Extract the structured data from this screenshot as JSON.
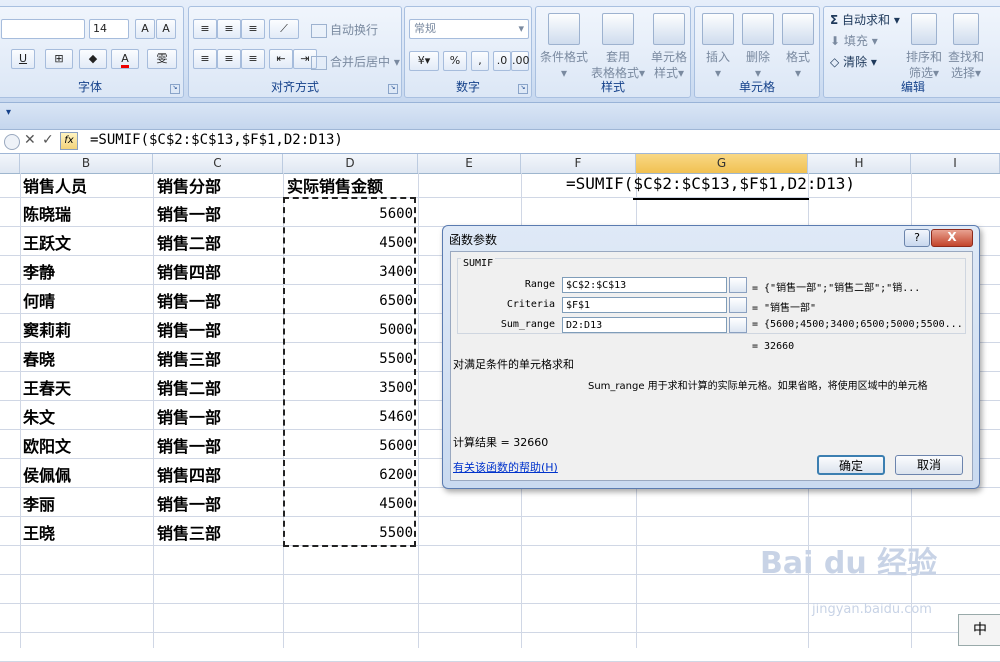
{
  "ribbon": {
    "font_group_label": "字体",
    "font_size": "14",
    "align_group_label": "对齐方式",
    "wrap_text": "自动换行",
    "merge_center": "合并后居中",
    "number_group_label": "数字",
    "number_format": "常规",
    "styles_group_label": "样式",
    "cond_format": "条件格式",
    "table_format_line1": "套用",
    "table_format_line2": "表格格式",
    "cell_style_line1": "单元格",
    "cell_style_line2": "样式",
    "cells_group_label": "单元格",
    "insert": "插入",
    "delete": "删除",
    "format": "格式",
    "edit_group_label": "编辑",
    "autosum": "自动求和",
    "fill": "填充",
    "clear": "清除",
    "sort_filter_line1": "排序和",
    "sort_filter_line2": "筛选",
    "find_select_line1": "查找和",
    "find_select_line2": "选择"
  },
  "formula_bar": {
    "fx": "fx",
    "formula": "=SUMIF($C$2:$C$13,$F$1,D2:D13)"
  },
  "columns": [
    "B",
    "C",
    "D",
    "E",
    "F",
    "G",
    "H",
    "I"
  ],
  "table": {
    "headers": [
      "销售人员",
      "销售分部",
      "实际销售金额"
    ],
    "rows": [
      [
        "陈晓瑞",
        "销售一部",
        "5600"
      ],
      [
        "王跃文",
        "销售二部",
        "4500"
      ],
      [
        "李静",
        "销售四部",
        "3400"
      ],
      [
        "何晴",
        "销售一部",
        "6500"
      ],
      [
        "窦莉莉",
        "销售一部",
        "5000"
      ],
      [
        "春晓",
        "销售三部",
        "5500"
      ],
      [
        "王春天",
        "销售二部",
        "3500"
      ],
      [
        "朱文",
        "销售一部",
        "5460"
      ],
      [
        "欧阳文",
        "销售一部",
        "5600"
      ],
      [
        "侯佩佩",
        "销售四部",
        "6200"
      ],
      [
        "李丽",
        "销售一部",
        "4500"
      ],
      [
        "王晓",
        "销售三部",
        "5500"
      ]
    ]
  },
  "cell_formula": "=SUMIF($C$2:$C$13,$F$1,D2:D13)",
  "dialog": {
    "title": "函数参数",
    "help_button": "?",
    "close_button": "X",
    "function_name": "SUMIF",
    "args": [
      {
        "label": "Range",
        "value": "$C$2:$C$13",
        "result": "= {\"销售一部\";\"销售二部\";\"销..."
      },
      {
        "label": "Criteria",
        "value": "$F$1",
        "result": "= \"销售一部\""
      },
      {
        "label": "Sum_range",
        "value": "D2:D13",
        "result": "= {5600;4500;3400;6500;5000;5500..."
      }
    ],
    "total": "= 32660",
    "description": "对满足条件的单元格求和",
    "param_desc": "Sum_range  用于求和计算的实际单元格。如果省略，将使用区域中的单元格",
    "calc_result": "计算结果 = 32660",
    "help_link": "有关该函数的帮助(H)",
    "ok": "确定",
    "cancel": "取消"
  },
  "watermark": {
    "brand": "Bai du 经验",
    "url": "jingyan.baidu.com"
  },
  "status_corner": "中"
}
